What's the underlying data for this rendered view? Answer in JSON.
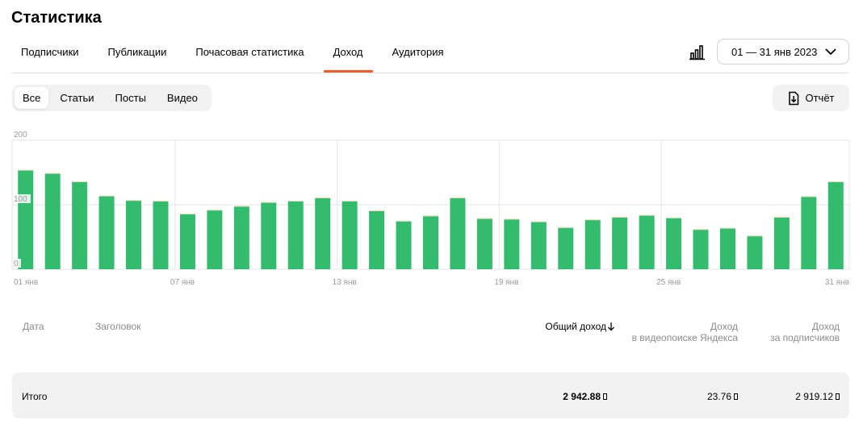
{
  "page_title": "Статистика",
  "tabs": [
    {
      "label": "Подписчики",
      "active": false
    },
    {
      "label": "Публикации",
      "active": false
    },
    {
      "label": "Почасовая статистика",
      "active": false
    },
    {
      "label": "Доход",
      "active": true
    },
    {
      "label": "Аудитория",
      "active": false
    }
  ],
  "date_range": "01 — 31 янв 2023",
  "filters": [
    {
      "label": "Все",
      "active": true
    },
    {
      "label": "Статьи",
      "active": false
    },
    {
      "label": "Посты",
      "active": false
    },
    {
      "label": "Видео",
      "active": false
    }
  ],
  "report_label": "Отчёт",
  "icons": {
    "chart_type": "bar-chart-icon",
    "dropdown": "chevron-down-icon",
    "report": "file-export-icon",
    "sort": "arrow-down-icon",
    "currency": "ruble-icon"
  },
  "colors": {
    "accent": "#ee5a2a",
    "bar_main": "#33bb6e",
    "bar_top": "#e9e3bf"
  },
  "chart_data": {
    "type": "bar",
    "x_tick_labels": [
      "01 янв",
      "07 янв",
      "13 янв",
      "19 янв",
      "25 янв",
      "31 янв"
    ],
    "y_tick_labels": [
      "200",
      "100",
      "0"
    ],
    "ylim": [
      0,
      200
    ],
    "grid": true,
    "categories": [
      "01",
      "02",
      "03",
      "04",
      "05",
      "06",
      "07",
      "08",
      "09",
      "10",
      "11",
      "12",
      "13",
      "14",
      "15",
      "16",
      "17",
      "18",
      "19",
      "20",
      "21",
      "22",
      "23",
      "24",
      "25",
      "26",
      "27",
      "28",
      "29",
      "30",
      "31"
    ],
    "series": [
      {
        "values": [
          153,
          148,
          135,
          113,
          106,
          105,
          85,
          91,
          97,
          103,
          105,
          110,
          105,
          90,
          74,
          82,
          110,
          78,
          77,
          73,
          64,
          76,
          80,
          83,
          79,
          61,
          63,
          51,
          80,
          112,
          135
        ]
      },
      {
        "values": [
          1.5,
          1.5,
          1.5,
          1.5,
          1.5,
          1.5,
          1.5,
          1.5,
          1.5,
          1.5,
          1.5,
          1.5,
          1.5,
          1.5,
          1.5,
          1.5,
          1.5,
          1.5,
          1.5,
          1.5,
          1.5,
          1.5,
          1.5,
          1.5,
          1.5,
          1.5,
          1.5,
          1.5,
          1.5,
          1.5,
          1.5
        ]
      }
    ]
  },
  "table": {
    "columns": {
      "date": "Дата",
      "title": "Заголовок",
      "total": "Общий доход",
      "video_line1": "Доход",
      "video_line2": "в видеопоиске Яндекса",
      "subs_line1": "Доход",
      "subs_line2": "за подписчиков"
    },
    "total_row": {
      "label": "Итого",
      "total": "2 942.88",
      "video": "23.76",
      "subs": "2 919.12"
    }
  }
}
